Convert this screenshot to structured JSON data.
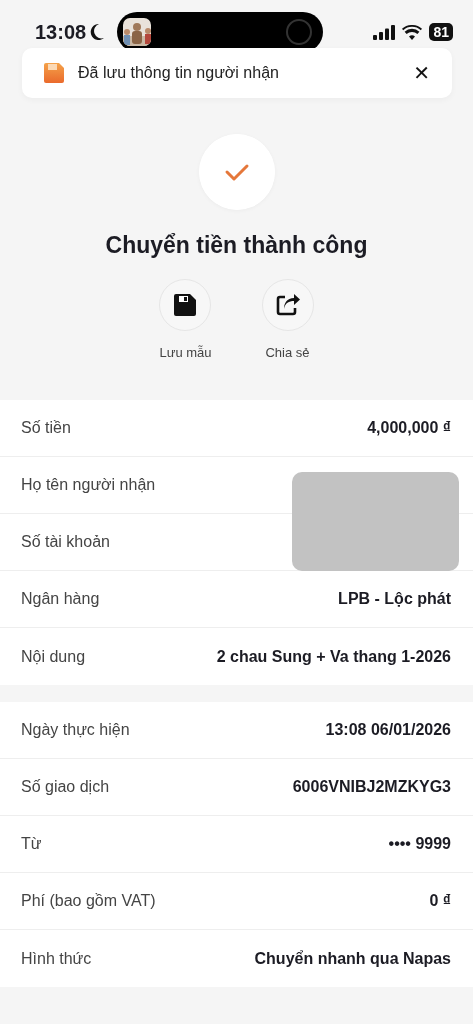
{
  "status_bar": {
    "time": "13:08",
    "battery": "81"
  },
  "notification": {
    "text": "Đã lưu thông tin người nhận",
    "close": "✕"
  },
  "result": {
    "title": "Chuyển tiền thành công"
  },
  "actions": [
    {
      "kind": "save",
      "label": "Lưu mẫu"
    },
    {
      "kind": "share",
      "label": "Chia sẻ"
    }
  ],
  "sections": [
    {
      "rows": [
        {
          "label": "Số tiền",
          "value": "4,000,000 ₫"
        },
        {
          "label": "Họ tên người nhận",
          "redacted": true
        },
        {
          "label": "Số tài khoản",
          "redacted": true
        },
        {
          "label": "Ngân hàng",
          "value": "LPB - Lộc phát"
        },
        {
          "label": "Nội dung",
          "value": "2 chau Sung + Va thang 1-2026"
        }
      ]
    },
    {
      "rows": [
        {
          "label": "Ngày thực hiện",
          "value": "13:08 06/01/2026"
        },
        {
          "label": "Số giao dịch",
          "value": "6006VNIBJ2MZKYG3"
        },
        {
          "label": "Từ",
          "value": "•••• 9999"
        },
        {
          "label": "Phí (bao gồm VAT)",
          "value": "0 ₫"
        },
        {
          "label": "Hình thức",
          "value": "Chuyển nhanh qua Napas"
        }
      ]
    }
  ]
}
